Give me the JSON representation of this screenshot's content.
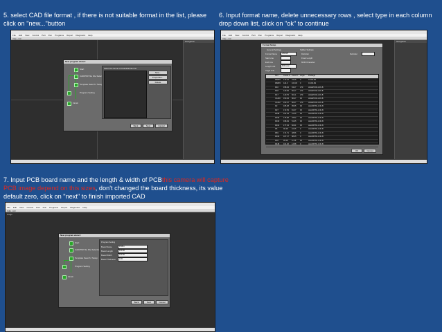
{
  "step5": {
    "caption": "5. select CAD file format   ,  if there is not suitable format in the list, please click on \"new...\"button"
  },
  "step6": {
    "caption": "6. Input format name, delete unnecessary rows    ,  select type in each column drop down list, click on \"ok\" to continue"
  },
  "step7": {
    "caption_a": "7. Input PCB board name  and the length & width of PCB",
    "caption_red": "this camera will capture PCB image depend on this sizes",
    "caption_b": ", don't changed the board thickness, its value default  zero, click on  \"next\" to finish imported CAD"
  },
  "app": {
    "title": "Xdlp_nit3",
    "menu": [
      "File",
      "Edit",
      "View",
      "Control",
      "Part",
      "Run",
      "Programs",
      "Report",
      "Diagnostic",
      "Help"
    ],
    "left_label": "Image",
    "nav_label": "Navigation"
  },
  "wizard": {
    "title": "New program wizard",
    "steps": [
      "Start",
      "CAD/PNP file File Selection",
      "Template Search / Setup",
      "Program Setting",
      "Finish"
    ],
    "back": "Back",
    "next": "Next",
    "cancel": "Cancel",
    "format_prompt": "Select the format of CAD/PNP file first",
    "format_buttons": [
      "New...",
      "Properties...",
      "Delete"
    ]
  },
  "format_dialog": {
    "title": "Format Setup",
    "general_label": "General Settings",
    "format_name_label": "Format Name",
    "format_name_value": "ASCiLP",
    "start_line_label": "Start Line",
    "end_line_label": "End Line",
    "length_unit_label": "Length Unit",
    "length_unit_value": "Millimeter",
    "angle_unit_label": "Angle Unit",
    "splitter_label": "Splitter Settings",
    "splitter_options": [
      "Delimiter",
      "Fixed Length",
      "Mt/Di Character"
    ],
    "delimiter_label": "Delimiter",
    "ok": "OK",
    "cancel": "Cancel",
    "columns": [
      "Part",
      "Coord.X",
      "Coord.Y",
      "Angle",
      "Package"
    ],
    "rows": [
      [
        "R68P2",
        "173.24",
        "43.28",
        "0",
        "0.1KR-B1"
      ],
      [
        "R68P2",
        "124.3",
        "100.33",
        "0",
        "0.1KR-B1"
      ],
      [
        "R10",
        "158.64",
        "63.17",
        "270",
        "HIGHPOW-1.0K-B"
      ],
      [
        "R18",
        "140.35",
        "50.17",
        "270",
        "HIGHPOW-1.0K-B"
      ],
      [
        "R17",
        "140.75",
        "50.11",
        "270",
        "HIGHPOW-1.0K-B"
      ],
      [
        "C1200",
        "150.04",
        "80.27",
        "90",
        "HIGHPOW-1.0K-B"
      ],
      [
        "C1202",
        "153.47",
        "80.27",
        "270",
        "HIGHPOW-1.0K-B"
      ],
      [
        "R2",
        "165.38",
        "95.05",
        "90",
        "LEADPOW-1.0K-B"
      ],
      [
        "R27",
        "172.53",
        "81.37",
        "90",
        "LEADPOW-1.0K-B"
      ],
      [
        "R338",
        "151.03",
        "41.25",
        "90",
        "LEADPOW-1.0K-B"
      ],
      [
        "R339",
        "175.98",
        "78.52",
        "90",
        "LEADPOW-1.0K-B"
      ],
      [
        "R340",
        "198.49",
        "51.35",
        "90",
        "LEADPOW-1.0K-B"
      ],
      [
        "R341",
        "177.43",
        "82.31",
        "90",
        "LEADPOW-1.0K-B"
      ],
      [
        "R5",
        "90.48",
        "10.45",
        "0",
        "LEADPOW-1.0K-B"
      ],
      [
        "R69",
        "171.71",
        "48.56",
        "0",
        "LEADPOW-1.0K-B"
      ],
      [
        "R344",
        "107.17",
        "88.45",
        "0",
        "LEADPOW-1.0K-B"
      ],
      [
        "R18",
        "95.28",
        "11.48",
        "90",
        "LEADPOW-1.0K-B"
      ],
      [
        "R448",
        "101.26",
        "12.58",
        "0",
        "LEADPOW-1.0K-B"
      ]
    ]
  },
  "board_setting": {
    "label": "Program Setting",
    "fields": [
      {
        "label": "Board Name",
        "value": "PCB-1"
      },
      {
        "label": "Board Length",
        "value": "100.00"
      },
      {
        "label": "Board Width",
        "value": "100.00"
      },
      {
        "label": "Board Thickness",
        "value": "0.00"
      }
    ]
  },
  "colors": {
    "background": "#1f4f8e",
    "caption": "#ffffff",
    "warning": "#e0281e",
    "step_node": "#2aa52a"
  }
}
